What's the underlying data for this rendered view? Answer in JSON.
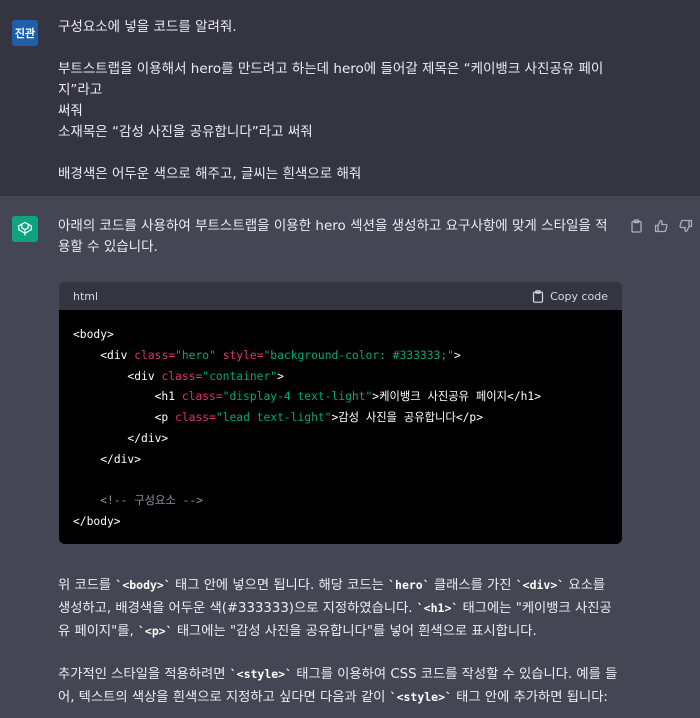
{
  "user": {
    "avatar_text": "진관",
    "lines": [
      "구성요소에 넣을 코드를 알려줘.",
      "",
      "부트스트랩을 이용해서 hero를 만드려고 하는데 hero에 들어갈 제목은 “케이뱅크 사진공유 페이지”라고",
      "써줘",
      "소재목은 “감성 사진을 공유합니다”라고 써줘",
      "",
      "배경색은 어두운 색으로 해주고, 글씨는 흰색으로 해줘"
    ]
  },
  "assistant": {
    "intro": "아래의 코드를 사용하여 부트스트랩을 이용한 hero 섹션을 생성하고 요구사항에 맞게 스타일을 적용할 수 있습니다.",
    "code_block": {
      "language": "html",
      "copy_label": "Copy code"
    },
    "code": {
      "body_open": "<body>",
      "div_open": "<div",
      "class_attr": "class=",
      "hero_value": "\"hero\"",
      "style_attr": "style=",
      "style_value": "\"background-color: #333333;\"",
      "gt": ">",
      "container_value": "\"container\"",
      "h1_open": "<h1",
      "h1_class_value": "\"display-4 text-light\"",
      "h1_text": ">케이뱅크 사진공유 페이지</h1>",
      "p_open": "<p",
      "p_class_value": "\"lead text-light\"",
      "p_text": ">감성 사진을 공유합니다</p>",
      "div_close": "</div>",
      "comment": "<!-- 구성요소 -->",
      "body_close": "</body>"
    },
    "para1": {
      "t1": "위 코드를 ",
      "c1": "`<body>`",
      "t2": " 태그 안에 넣으면 됩니다. 해당 코드는 ",
      "c2": "`hero`",
      "t3": " 클래스를 가진 ",
      "c3": "`<div>`",
      "t4": " 요소를 생성하고, 배경색을 어두운 색(#333333)으로 지정하였습니다. ",
      "c4": "`<h1>`",
      "t5": " 태그에는 \"케이뱅크 사진공유 페이지\"를, ",
      "c5": "`<p>`",
      "t6": " 태그에는 \"감성 사진을 공유합니다\"를 넣어 흰색으로 표시합니다."
    },
    "para2": {
      "t1": "추가적인 스타일을 적용하려면 ",
      "c1": "`<style>`",
      "t2": " 태그를 이용하여 CSS 코드를 작성할 수 있습니다. 예를 들어, 텍스트의 색상을 흰색으로 지정하고 싶다면 다음과 같이 ",
      "c2": "`<style>`",
      "t3": " 태그 안에 추가하면 됩니다:"
    }
  },
  "icons": {
    "copy_message": "clipboard-icon",
    "thumbs_up": "thumbs-up-icon",
    "thumbs_down": "thumbs-down-icon",
    "gpt_logo": "openai-logo-icon"
  },
  "colors": {
    "user_bg": "#343541",
    "assistant_bg": "#444654",
    "gpt_avatar": "#10a37f",
    "user_avatar": "#1d5fa8",
    "code_attr": "#df3079",
    "code_string": "#00a67d"
  }
}
